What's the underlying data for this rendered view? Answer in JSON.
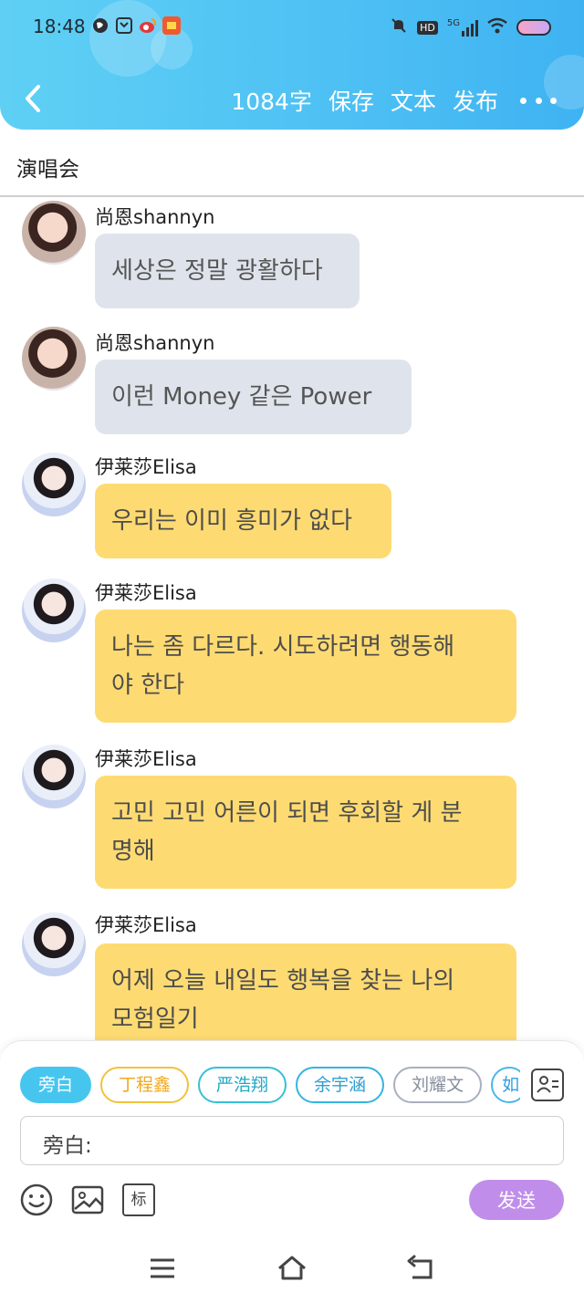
{
  "status_bar": {
    "time": "18:48",
    "network_label": "5G",
    "hd_label": "HD"
  },
  "header": {
    "word_count": "1084字",
    "save_label": "保存",
    "text_label": "文本",
    "publish_label": "发布",
    "accent_color": "#52c4f4"
  },
  "title": "演唱会",
  "messages": [
    {
      "sender": "尚恩shannyn",
      "text": "세상은 정말 광활하다",
      "style": "gray"
    },
    {
      "sender": "尚恩shannyn",
      "text": "이런 Money 같은 Power",
      "style": "gray"
    },
    {
      "sender": "伊莱莎Elisa",
      "text": "우리는 이미 흥미가 없다",
      "style": "yellow"
    },
    {
      "sender": "伊莱莎Elisa",
      "text_line1": "나는 좀 다르다. 시도하려면 행동해",
      "text_line2": "야 한다",
      "style": "yellow"
    },
    {
      "sender": "伊莱莎Elisa",
      "text_line1": "고민 고민 어른이 되면 후회할 게 분",
      "text_line2": "명해",
      "style": "yellow"
    },
    {
      "sender": "伊莱莎Elisa",
      "text_line1": "어제 오늘 내일도 행복을 찾는 나의",
      "text_line2": "모험일기",
      "style": "yellow"
    }
  ],
  "composer": {
    "chips": [
      "旁白",
      "丁程鑫",
      "严浩翔",
      "余宇涵",
      "刘耀文",
      "如"
    ],
    "input_label": "旁白:",
    "mark_label": "标",
    "send_label": "发送",
    "send_color": "#c08eea"
  }
}
